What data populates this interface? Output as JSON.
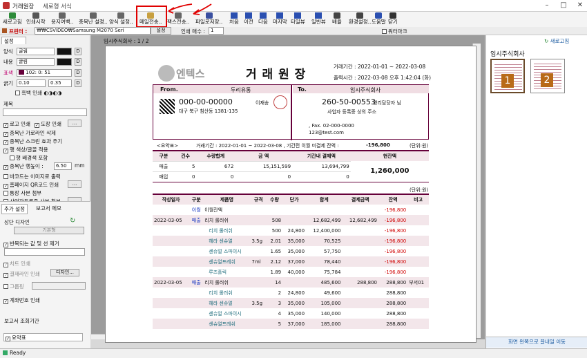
{
  "window": {
    "title": "거래원장",
    "subtitle": "세로형 서식"
  },
  "toolbar": {
    "items": [
      {
        "label": "새로고침",
        "icon": "refresh-icon",
        "color": "#2e8b3a"
      },
      {
        "label": "인쇄시작",
        "icon": "printer-icon",
        "color": "#555555"
      },
      {
        "label": "용지여백..",
        "icon": "page-margin-icon",
        "color": "#666666"
      },
      {
        "label": "종목난 설정..",
        "icon": "column-settings-icon",
        "color": "#666666"
      },
      {
        "label": "양식 설정..",
        "icon": "form-settings-icon",
        "color": "#666666"
      },
      {
        "label": "메일전송..",
        "icon": "mail-icon",
        "color": "#c8a040"
      },
      {
        "label": "팩스전송..",
        "icon": "fax-icon",
        "color": "#666666"
      },
      {
        "label": "파일로저장..",
        "icon": "save-file-icon",
        "color": "#3a50a0"
      },
      {
        "label": "처음",
        "icon": "first-page-icon",
        "color": "#2a4fb0"
      },
      {
        "label": "이전",
        "icon": "prev-page-icon",
        "color": "#2a4fb0"
      },
      {
        "label": "다음",
        "icon": "next-page-icon",
        "color": "#2a4fb0"
      },
      {
        "label": "마지막",
        "icon": "last-page-icon",
        "color": "#2a4fb0"
      },
      {
        "label": "타일뷰",
        "icon": "tile-view-icon",
        "color": "#2a4fb0"
      },
      {
        "label": "일반뷰",
        "icon": "normal-view-icon",
        "color": "#2a4fb0"
      },
      {
        "label": "배율",
        "icon": "zoom-icon",
        "color": "#444444"
      },
      {
        "label": "환경설정..",
        "icon": "settings-icon",
        "color": "#444444"
      },
      {
        "label": "도움말",
        "icon": "help-icon",
        "color": "#2a4fb0"
      },
      {
        "label": "닫기",
        "icon": "close-icon",
        "color": "#333333"
      }
    ]
  },
  "printer": {
    "label": "프린터 :",
    "path": "₩₩CSVIDEO₩Samsung M2070 Seri",
    "settings": "설정",
    "copies_label": "인쇄 매수 :",
    "copies": "1",
    "watermark": "워터마크"
  },
  "left": {
    "tab": "설정",
    "style_label": "양식",
    "style_font": "굴림",
    "content_label": "내용",
    "content_font": "굴림",
    "table_label": "표색",
    "table_color": "102: 0: 51",
    "size_label": "굵기",
    "size_a": "0.10",
    "size_b": "0.35",
    "bw_print": "흑백 인쇄",
    "bw_dots": "◐◑◐◑",
    "title_label": "제목",
    "options": [
      {
        "label": "로고 인쇄",
        "checked": true
      },
      {
        "label": "종목난 가로라인 삭제",
        "checked": true
      },
      {
        "label": "종목난 스크린 효과 주기",
        "checked": true
      },
      {
        "label": "행 색상/글꼴 적용",
        "checked": true
      },
      {
        "label": "행 배경색 포함",
        "checked": false
      },
      {
        "label": "종목난 행높이 :",
        "checked": true,
        "value": "6.50",
        "unit": "mm"
      },
      {
        "label": "바코드는 이미지로 출력",
        "checked": false
      },
      {
        "label": "홈페이지 QR코드 인쇄",
        "checked": true
      },
      {
        "label": "통장 사본 첨부",
        "checked": false
      },
      {
        "label": "사업자등록증 사본 첨부",
        "checked": false
      }
    ],
    "stamp": "도장 인쇄",
    "tab2": "추가 설정",
    "tab3": "보고서 메모",
    "design": "상단 디자인",
    "basic": "기본형",
    "repeat": "반복되는 값 및 선 제거",
    "chart": "차트 인쇄",
    "ledger": "결재라인 인쇄",
    "design_btn": "디자인...",
    "group": "그룹핑",
    "account": "계좌번호 인쇄",
    "period": "보고서 조회기간",
    "summary": "요약표"
  },
  "doc": {
    "header": "임시주식회사 : 1 / 2",
    "logo": "엔텍스",
    "title": "거 래 원 장",
    "period": "거래기간 : 2022-01-01 ~ 2022-03-08",
    "output": "출력시간 : 2022-03-08 오후 1:42:04 (화)",
    "from_label": "From.",
    "from_name": "두리유통",
    "from_no": "000-00-00000",
    "from_ceo": "이재송",
    "from_addr": "대구 북구 침산동 1381-135",
    "to_label": "To.",
    "to_name": "임시주식회사",
    "to_no": "260-50-00553",
    "to_mgr": "경리담당자 님",
    "to_addr": "사업자 등록증 상의 주소",
    "to_fax": ", Fax. 02-000-0000",
    "to_mail": "123@test.com",
    "summary_title": "<요약표>",
    "summary_range": "거래기간 : 2022-01-01 ~ 2022-03-08 , 기간전 이월 미결제 잔액 :",
    "summary_balance": "-196,800",
    "unit": "(단위:원)",
    "sum_head": [
      "구분",
      "건수",
      "수량합계",
      "금 액",
      "기간내 결제액",
      "현잔액"
    ],
    "sum_rows": [
      [
        "매출",
        "5",
        "672",
        "15,151,599",
        "13,694,799"
      ],
      [
        "매입",
        "0",
        "0",
        "0",
        "0"
      ]
    ],
    "sum_total": "1,260,000",
    "head": [
      "작성일자",
      "구분",
      "제품명",
      "규격",
      "수량",
      "단가",
      "합계",
      "결제금액",
      "잔액",
      "비고"
    ],
    "rows": [
      {
        "date": "",
        "kind": "이월",
        "name": "이월잔액",
        "spec": "",
        "qty": "",
        "price": "",
        "sum": "",
        "paid": "",
        "bal": "-196,800",
        "note": "",
        "pink": false
      },
      {
        "date": "2022-03-05",
        "kind": "매출",
        "name": "리치 롤러쉬",
        "spec": "",
        "qty": "508",
        "price": "",
        "sum": "12,682,499",
        "paid": "12,682,499",
        "bal": "-196,800",
        "note": "",
        "pink": true
      },
      {
        "date": "",
        "kind": "",
        "name": "리치 롤러쉬",
        "spec": "",
        "qty": "500",
        "price": "24,800",
        "sum": "12,400,000",
        "paid": "",
        "bal": "-196,800",
        "note": "",
        "pink": false
      },
      {
        "date": "",
        "kind": "",
        "name": "헤라 센슈얼",
        "spec": "3.5g",
        "qty": "2.01",
        "price": "35,000",
        "sum": "70,525",
        "paid": "",
        "bal": "-196,800",
        "note": "",
        "pink": true
      },
      {
        "date": "",
        "kind": "",
        "name": "센슈얼 스파이시",
        "spec": "",
        "qty": "1.65",
        "price": "35,000",
        "sum": "57,750",
        "paid": "",
        "bal": "-196,800",
        "note": "",
        "pink": false
      },
      {
        "date": "",
        "kind": "",
        "name": "센슈얼프레쉬",
        "spec": "7ml",
        "qty": "2.12",
        "price": "37,000",
        "sum": "78,440",
        "paid": "",
        "bal": "-196,800",
        "note": "",
        "pink": true
      },
      {
        "date": "",
        "kind": "",
        "name": "루즈홀릭",
        "spec": "",
        "qty": "1.89",
        "price": "40,000",
        "sum": "75,784",
        "paid": "",
        "bal": "-196,800",
        "note": "",
        "pink": false
      },
      {
        "date": "2022-03-05",
        "kind": "매출",
        "name": "리치 롤러쉬",
        "spec": "",
        "qty": "14",
        "price": "",
        "sum": "485,600",
        "paid": "288,800",
        "bal": "288,800",
        "note": "부서01",
        "pink": true
      },
      {
        "date": "",
        "kind": "",
        "name": "리치 롤러쉬",
        "spec": "",
        "qty": "2",
        "price": "24,800",
        "sum": "49,600",
        "paid": "",
        "bal": "288,800",
        "note": "",
        "pink": false
      },
      {
        "date": "",
        "kind": "",
        "name": "헤라 센슈얼",
        "spec": "3.5g",
        "qty": "3",
        "price": "35,000",
        "sum": "105,000",
        "paid": "",
        "bal": "288,800",
        "note": "",
        "pink": true
      },
      {
        "date": "",
        "kind": "",
        "name": "센슈얼 스파이시",
        "spec": "",
        "qty": "4",
        "price": "35,000",
        "sum": "140,000",
        "paid": "",
        "bal": "288,800",
        "note": "",
        "pink": false
      },
      {
        "date": "",
        "kind": "",
        "name": "센슈얼프레쉬",
        "spec": "",
        "qty": "5",
        "price": "37,000",
        "sum": "185,000",
        "paid": "",
        "bal": "288,800",
        "note": "",
        "pink": true
      }
    ]
  },
  "right": {
    "refresh": "새로고침",
    "company": "임시주식회사",
    "page1": "1",
    "page2": "2",
    "hint": "화면 왼쪽으로 끌내일 이동"
  },
  "status": {
    "text": "Ready"
  },
  "colors": {
    "accent": "#66003a",
    "red": "#d00000",
    "blue": "#1030c0",
    "annotation": "#e00000"
  }
}
